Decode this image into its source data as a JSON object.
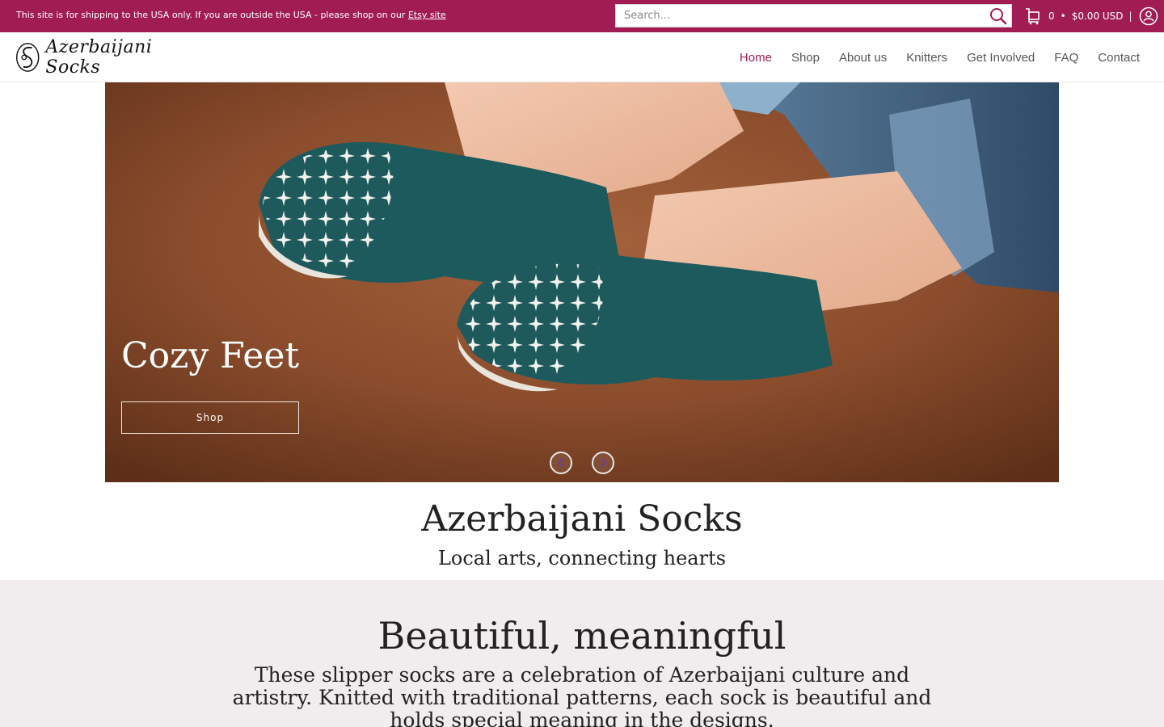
{
  "topbar": {
    "notice_text": "This site is for shipping to the USA only. If you are outside the USA - please shop on our ",
    "notice_link": "Etsy site",
    "search_placeholder": "Search...",
    "cart_count": "0",
    "cart_separator": "•",
    "cart_total": "$0.00 USD",
    "divider": "|"
  },
  "header": {
    "logo_text": "Azerbaijani Socks",
    "nav": [
      {
        "label": "Home"
      },
      {
        "label": "Shop"
      },
      {
        "label": "About us"
      },
      {
        "label": "Knitters"
      },
      {
        "label": "Get Involved"
      },
      {
        "label": "FAQ"
      },
      {
        "label": "Contact"
      }
    ]
  },
  "hero": {
    "title": "Cozy Feet",
    "button_label": "Shop"
  },
  "intro": {
    "title": "Azerbaijani Socks",
    "subtitle": "Local arts, connecting hearts"
  },
  "feature": {
    "title": "Beautiful, meaningful",
    "body": "These slipper socks are a celebration of Azerbaijani culture and artistry. Knitted with traditional patterns, each sock is beautiful and holds special meaning in the designs."
  },
  "colors": {
    "brand": "#a21c54",
    "feature_bg": "#f1ecee",
    "nav_text": "#555555"
  },
  "icons": {
    "search": "search-icon",
    "cart": "cart-icon",
    "account": "account-icon",
    "prev": "chevron-left-icon",
    "next": "chevron-right-icon"
  }
}
